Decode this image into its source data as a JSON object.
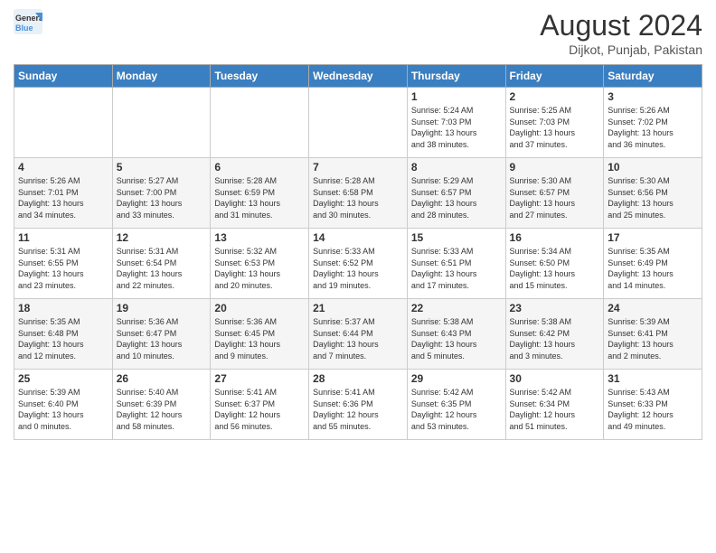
{
  "header": {
    "logo_line1": "General",
    "logo_line2": "Blue",
    "month": "August 2024",
    "location": "Dijkot, Punjab, Pakistan"
  },
  "weekdays": [
    "Sunday",
    "Monday",
    "Tuesday",
    "Wednesday",
    "Thursday",
    "Friday",
    "Saturday"
  ],
  "weeks": [
    [
      {
        "day": "",
        "info": ""
      },
      {
        "day": "",
        "info": ""
      },
      {
        "day": "",
        "info": ""
      },
      {
        "day": "",
        "info": ""
      },
      {
        "day": "1",
        "info": "Sunrise: 5:24 AM\nSunset: 7:03 PM\nDaylight: 13 hours\nand 38 minutes."
      },
      {
        "day": "2",
        "info": "Sunrise: 5:25 AM\nSunset: 7:03 PM\nDaylight: 13 hours\nand 37 minutes."
      },
      {
        "day": "3",
        "info": "Sunrise: 5:26 AM\nSunset: 7:02 PM\nDaylight: 13 hours\nand 36 minutes."
      }
    ],
    [
      {
        "day": "4",
        "info": "Sunrise: 5:26 AM\nSunset: 7:01 PM\nDaylight: 13 hours\nand 34 minutes."
      },
      {
        "day": "5",
        "info": "Sunrise: 5:27 AM\nSunset: 7:00 PM\nDaylight: 13 hours\nand 33 minutes."
      },
      {
        "day": "6",
        "info": "Sunrise: 5:28 AM\nSunset: 6:59 PM\nDaylight: 13 hours\nand 31 minutes."
      },
      {
        "day": "7",
        "info": "Sunrise: 5:28 AM\nSunset: 6:58 PM\nDaylight: 13 hours\nand 30 minutes."
      },
      {
        "day": "8",
        "info": "Sunrise: 5:29 AM\nSunset: 6:57 PM\nDaylight: 13 hours\nand 28 minutes."
      },
      {
        "day": "9",
        "info": "Sunrise: 5:30 AM\nSunset: 6:57 PM\nDaylight: 13 hours\nand 27 minutes."
      },
      {
        "day": "10",
        "info": "Sunrise: 5:30 AM\nSunset: 6:56 PM\nDaylight: 13 hours\nand 25 minutes."
      }
    ],
    [
      {
        "day": "11",
        "info": "Sunrise: 5:31 AM\nSunset: 6:55 PM\nDaylight: 13 hours\nand 23 minutes."
      },
      {
        "day": "12",
        "info": "Sunrise: 5:31 AM\nSunset: 6:54 PM\nDaylight: 13 hours\nand 22 minutes."
      },
      {
        "day": "13",
        "info": "Sunrise: 5:32 AM\nSunset: 6:53 PM\nDaylight: 13 hours\nand 20 minutes."
      },
      {
        "day": "14",
        "info": "Sunrise: 5:33 AM\nSunset: 6:52 PM\nDaylight: 13 hours\nand 19 minutes."
      },
      {
        "day": "15",
        "info": "Sunrise: 5:33 AM\nSunset: 6:51 PM\nDaylight: 13 hours\nand 17 minutes."
      },
      {
        "day": "16",
        "info": "Sunrise: 5:34 AM\nSunset: 6:50 PM\nDaylight: 13 hours\nand 15 minutes."
      },
      {
        "day": "17",
        "info": "Sunrise: 5:35 AM\nSunset: 6:49 PM\nDaylight: 13 hours\nand 14 minutes."
      }
    ],
    [
      {
        "day": "18",
        "info": "Sunrise: 5:35 AM\nSunset: 6:48 PM\nDaylight: 13 hours\nand 12 minutes."
      },
      {
        "day": "19",
        "info": "Sunrise: 5:36 AM\nSunset: 6:47 PM\nDaylight: 13 hours\nand 10 minutes."
      },
      {
        "day": "20",
        "info": "Sunrise: 5:36 AM\nSunset: 6:45 PM\nDaylight: 13 hours\nand 9 minutes."
      },
      {
        "day": "21",
        "info": "Sunrise: 5:37 AM\nSunset: 6:44 PM\nDaylight: 13 hours\nand 7 minutes."
      },
      {
        "day": "22",
        "info": "Sunrise: 5:38 AM\nSunset: 6:43 PM\nDaylight: 13 hours\nand 5 minutes."
      },
      {
        "day": "23",
        "info": "Sunrise: 5:38 AM\nSunset: 6:42 PM\nDaylight: 13 hours\nand 3 minutes."
      },
      {
        "day": "24",
        "info": "Sunrise: 5:39 AM\nSunset: 6:41 PM\nDaylight: 13 hours\nand 2 minutes."
      }
    ],
    [
      {
        "day": "25",
        "info": "Sunrise: 5:39 AM\nSunset: 6:40 PM\nDaylight: 13 hours\nand 0 minutes."
      },
      {
        "day": "26",
        "info": "Sunrise: 5:40 AM\nSunset: 6:39 PM\nDaylight: 12 hours\nand 58 minutes."
      },
      {
        "day": "27",
        "info": "Sunrise: 5:41 AM\nSunset: 6:37 PM\nDaylight: 12 hours\nand 56 minutes."
      },
      {
        "day": "28",
        "info": "Sunrise: 5:41 AM\nSunset: 6:36 PM\nDaylight: 12 hours\nand 55 minutes."
      },
      {
        "day": "29",
        "info": "Sunrise: 5:42 AM\nSunset: 6:35 PM\nDaylight: 12 hours\nand 53 minutes."
      },
      {
        "day": "30",
        "info": "Sunrise: 5:42 AM\nSunset: 6:34 PM\nDaylight: 12 hours\nand 51 minutes."
      },
      {
        "day": "31",
        "info": "Sunrise: 5:43 AM\nSunset: 6:33 PM\nDaylight: 12 hours\nand 49 minutes."
      }
    ]
  ]
}
